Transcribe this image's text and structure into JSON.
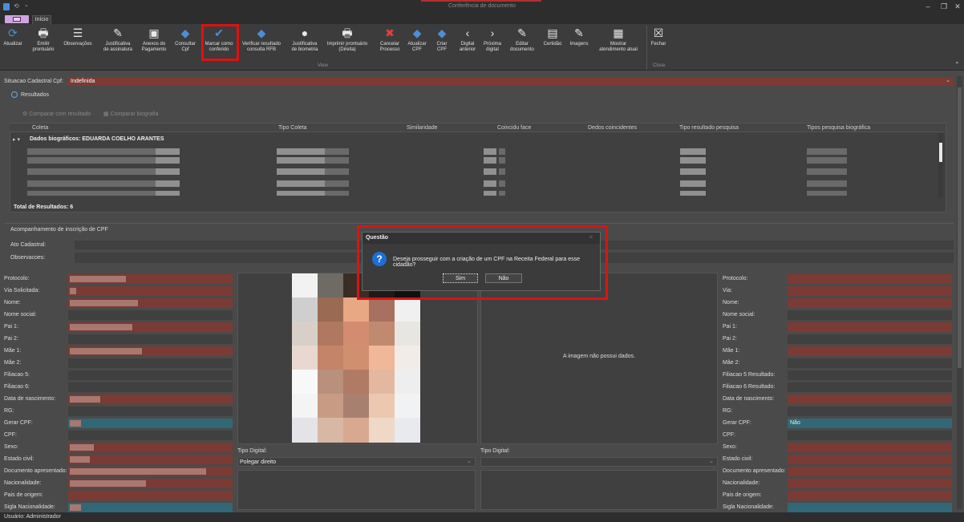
{
  "window": {
    "title": "Conferência de documento",
    "minimize": "–",
    "maximize": "❐",
    "close": "✕"
  },
  "tabs": {
    "inicio": "Início"
  },
  "ribbon": {
    "buttons": [
      {
        "label1": "Atualizar",
        "label2": "",
        "icon": "refresh-icon"
      },
      {
        "label1": "Emitir",
        "label2": "prontuário",
        "icon": "printer-icon"
      },
      {
        "label1": "Observações",
        "label2": "",
        "icon": "list-icon"
      },
      {
        "label1": "Justificativa",
        "label2": "de assinatura",
        "icon": "pen-icon"
      },
      {
        "label1": "Anexos do",
        "label2": "Pagamento",
        "icon": "attachment-icon"
      },
      {
        "label1": "Consultar",
        "label2": "Cpf",
        "icon": "cpf-icon"
      },
      {
        "label1": "Marcar como",
        "label2": "conferido",
        "icon": "check-icon"
      },
      {
        "label1": "Verificar resultado",
        "label2": "consulta RFB",
        "icon": "cpf-icon"
      },
      {
        "label1": "Justificativa",
        "label2": "de biometria",
        "icon": "user-icon"
      },
      {
        "label1": "Imprimir prontuário",
        "label2": "(Direita)",
        "icon": "printer-icon"
      },
      {
        "label1": "Cancelar",
        "label2": "Processo",
        "icon": "cancel-doc-icon"
      },
      {
        "label1": "Atualizar",
        "label2": "CPF",
        "icon": "cpf-icon"
      },
      {
        "label1": "Criar",
        "label2": "CPF",
        "icon": "cpf-icon"
      },
      {
        "label1": "Digital",
        "label2": "anterior",
        "icon": "chevron-left-icon"
      },
      {
        "label1": "Próxima",
        "label2": "digital",
        "icon": "chevron-right-icon"
      },
      {
        "label1": "Editar",
        "label2": "documento",
        "icon": "edit-doc-icon"
      },
      {
        "label1": "Certidão",
        "label2": "",
        "icon": "document-icon"
      },
      {
        "label1": "Imagens",
        "label2": "",
        "icon": "edit-doc-icon"
      },
      {
        "label1": "Mostrar",
        "label2": "atendimento atual",
        "icon": "form-icon"
      },
      {
        "label1": "Fechar",
        "label2": "",
        "icon": "close-box-icon"
      }
    ],
    "groups": {
      "view": "View",
      "close": "Close"
    }
  },
  "situacao": {
    "label": "Situacao Cadastral Cpf:",
    "value": "Indefinida"
  },
  "resultados": {
    "label": "Resultados",
    "compare_result": "Comparar com resultado",
    "compare_bio": "Comparar biografia"
  },
  "grid": {
    "columns": [
      "Coleta",
      "Tipo Coleta",
      "Similaridade",
      "Coincidu face",
      "Dedos coincidentes",
      "Tipo resultado pesquisa",
      "Tipos pesquisa biográfica"
    ],
    "group_row": "Dados biográficos: EDUARDA COELHO ARANTES",
    "total": "Total de Resultados: 6"
  },
  "acompanhamento": {
    "title": "Acompanhamento de inscrição de CPF",
    "ato": "Ato Cadastral:",
    "obs": "Observacoes:"
  },
  "left_form": {
    "labels": [
      "Protocolo:",
      "Via Solicitada:",
      "Nome:",
      "Nome social:",
      "Pai 1:",
      "Pai 2:",
      "Mãe 1:",
      "Mãe 2:",
      "Filiacao 5:",
      "Filiacao 6:",
      "Data de nascimento:",
      "RG:",
      "Gerar CPF:",
      "CPF:",
      "Sexo:",
      "Estado civil:",
      "Documento apresentado:",
      "Nacionalidade:",
      "Pais de origem:",
      "Sigla Nacionalidade:"
    ]
  },
  "right_form": {
    "labels": [
      "Protocolo:",
      "Via:",
      "Nome:",
      "Nome social:",
      "Pai 1:",
      "Pai 2:",
      "Mãe 1:",
      "Mãe 2:",
      "Filiacao 5 Resultado:",
      "Filiacao 6 Resultado:",
      "Data de nascimento:",
      "RG:",
      "Gerar CPF:",
      "CPF:",
      "Sexo:",
      "Estado civil:",
      "Documento apresentado:",
      "Nacionalidade:",
      "Pais de origem:",
      "Sigla Nacionalidade:"
    ],
    "gerar_cpf_value": "Não"
  },
  "center": {
    "no_image": "A imagem não possui dados.",
    "tipo_digital_left": "Tipo Digital:",
    "tipo_digital_left_value": "Polegar direito",
    "tipo_digital_right": "Tipo Digital:"
  },
  "dialog": {
    "title": "Questão",
    "message": "Deseja prosseguir com a criação de um CPF na Receita Federal para esse cidadão?",
    "yes": "Sim",
    "no": "Não",
    "icon": "question-icon"
  },
  "status": {
    "user": "Usuário: Administrador"
  },
  "colors": {
    "accent_red": "#e01010",
    "field_red": "#7c3a34",
    "field_teal": "#316776",
    "icon_blue": "#4a8fd8"
  }
}
